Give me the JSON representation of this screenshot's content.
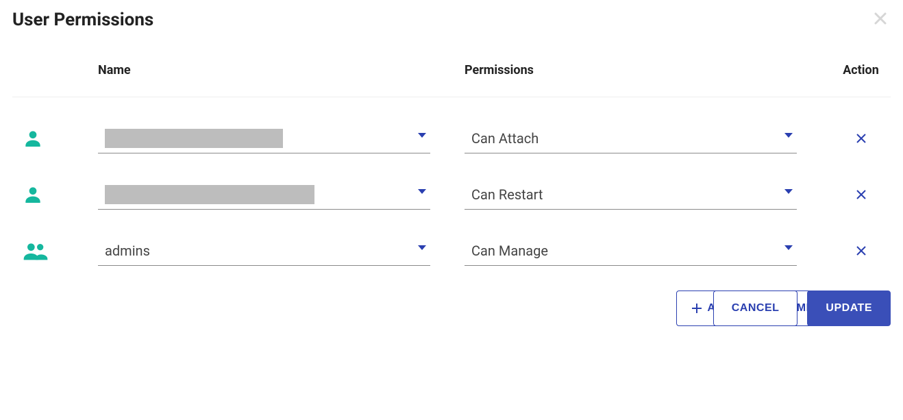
{
  "modal": {
    "title": "User Permissions"
  },
  "headers": {
    "name": "Name",
    "permissions": "Permissions",
    "action": "Action"
  },
  "rows": [
    {
      "icon": "person",
      "name_redacted": true,
      "name": "",
      "permission": "Can Attach"
    },
    {
      "icon": "person",
      "name_redacted": true,
      "name": "",
      "permission": "Can Restart"
    },
    {
      "icon": "group",
      "name_redacted": false,
      "name": "admins",
      "permission": "Can Manage"
    }
  ],
  "buttons": {
    "add_more": "ADD MORE PERMISSIONS",
    "cancel": "CANCEL",
    "update": "UPDATE"
  },
  "colors": {
    "accent_blue": "#2a3fb0",
    "primary_blue": "#3a4fb8",
    "teal": "#15b79e",
    "redacted_gray": "#bdbdbd"
  }
}
